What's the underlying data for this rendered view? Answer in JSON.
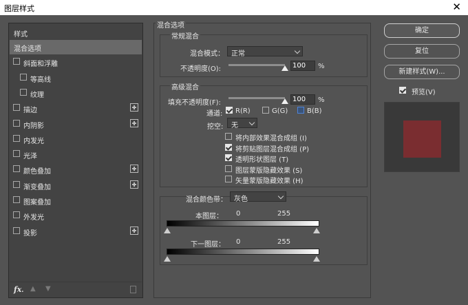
{
  "window": {
    "title": "图层样式",
    "close_glyph": "✕"
  },
  "left_panel": {
    "header": "样式",
    "items": [
      {
        "label": "混合选项",
        "checkbox": false,
        "plus": false,
        "indent": 0,
        "selected": true
      },
      {
        "label": "斜面和浮雕",
        "checkbox": true,
        "plus": false,
        "indent": 0
      },
      {
        "label": "等高线",
        "checkbox": true,
        "plus": false,
        "indent": 1
      },
      {
        "label": "纹理",
        "checkbox": true,
        "plus": false,
        "indent": 1
      },
      {
        "label": "描边",
        "checkbox": true,
        "plus": true,
        "indent": 0
      },
      {
        "label": "内阴影",
        "checkbox": true,
        "plus": true,
        "indent": 0
      },
      {
        "label": "内发光",
        "checkbox": true,
        "plus": false,
        "indent": 0
      },
      {
        "label": "光泽",
        "checkbox": true,
        "plus": false,
        "indent": 0
      },
      {
        "label": "颜色叠加",
        "checkbox": true,
        "plus": true,
        "indent": 0
      },
      {
        "label": "渐变叠加",
        "checkbox": true,
        "plus": true,
        "indent": 0
      },
      {
        "label": "图案叠加",
        "checkbox": true,
        "plus": false,
        "indent": 0
      },
      {
        "label": "外发光",
        "checkbox": true,
        "plus": false,
        "indent": 0
      },
      {
        "label": "投影",
        "checkbox": true,
        "plus": true,
        "indent": 0
      }
    ],
    "footer": {
      "fx_label": "fx",
      "fx_dot": ".",
      "up_icon": "triangle-up-icon",
      "down_icon": "triangle-down-icon",
      "trash_icon": "trash-icon"
    }
  },
  "blend": {
    "section_title": "混合选项",
    "general": {
      "title": "常规混合",
      "mode_label": "混合模式：",
      "mode_value": "正常",
      "opacity_label": "不透明度(O):",
      "opacity_value": "100",
      "opacity_unit": "%",
      "opacity_fraction": 1.0
    },
    "advanced": {
      "title": "高级混合",
      "fill_label": "填充不透明度(F):",
      "fill_value": "100",
      "fill_unit": "%",
      "fill_fraction": 1.0,
      "channels_label": "通道:",
      "channels": [
        {
          "label": "R(R)",
          "checked": true
        },
        {
          "label": "G(G)",
          "checked": false
        },
        {
          "label": "B(B)",
          "checked": false,
          "highlight": true
        }
      ],
      "knockout_label": "挖空:",
      "knockout_value": "无",
      "options": [
        {
          "label": "将内部效果混合成组 (I)",
          "checked": false
        },
        {
          "label": "将剪贴图层混合成组 (P)",
          "checked": true
        },
        {
          "label": "透明形状图层 (T)",
          "checked": true
        },
        {
          "label": "图层蒙版隐藏效果 (S)",
          "checked": false
        },
        {
          "label": "矢量蒙版隐藏效果 (H)",
          "checked": false
        }
      ]
    },
    "blend_if": {
      "label": "混合颜色带：",
      "value": "灰色",
      "this_layer": {
        "label": "本图层：",
        "low": "0",
        "high": "255"
      },
      "underlying": {
        "label": "下一图层：",
        "low": "0",
        "high": "255"
      }
    }
  },
  "right": {
    "ok_label": "确定",
    "reset_label": "复位",
    "new_style_label": "新建样式(W)...",
    "preview_label": "预览(V)",
    "preview_checked": true,
    "preview_swatch_color": "#7a2d30",
    "preview_bg_color": "#393939"
  }
}
